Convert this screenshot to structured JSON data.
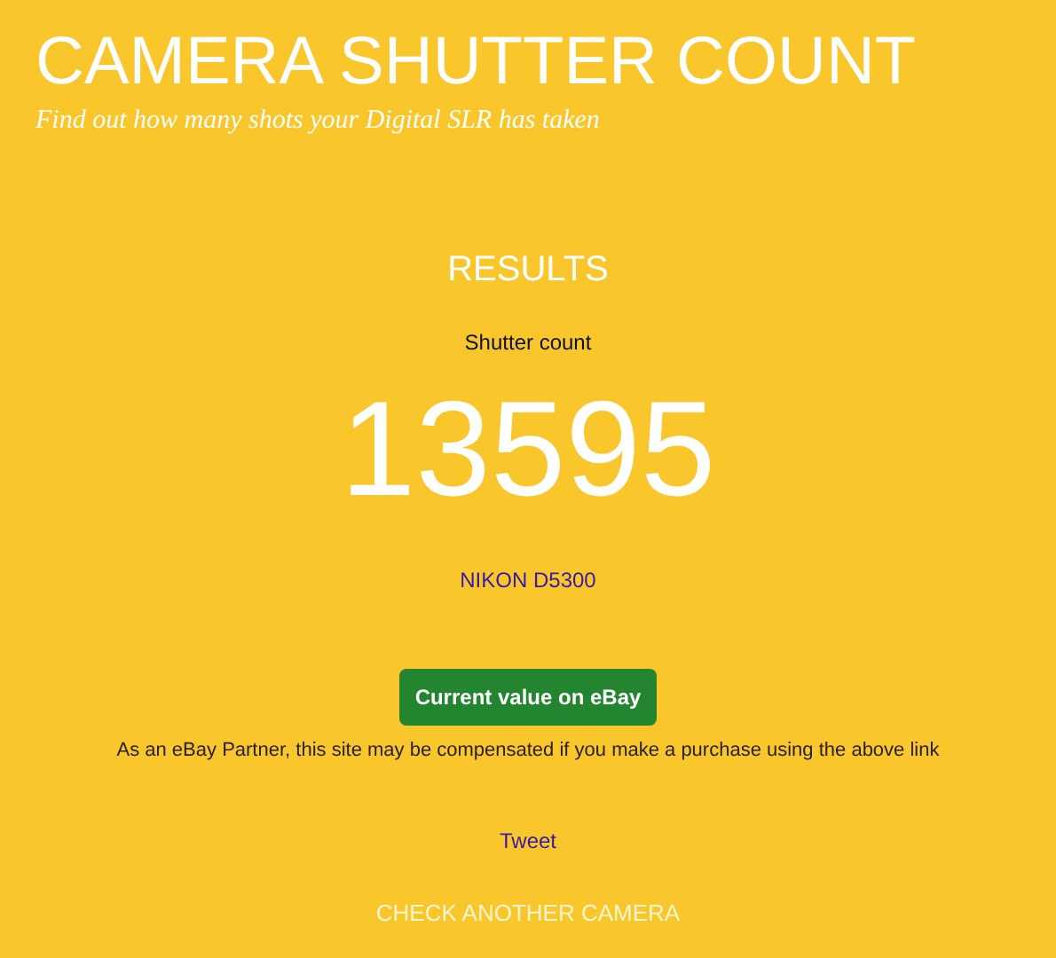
{
  "header": {
    "title": "CAMERA SHUTTER COUNT",
    "tagline": "Find out how many shots your Digital SLR has taken"
  },
  "results": {
    "heading": "RESULTS",
    "label": "Shutter count",
    "count": "13595",
    "camera_model": "NIKON D5300"
  },
  "ebay_button": "Current value on eBay",
  "disclaimer": "As an eBay Partner, this site may be compensated if you make a purchase using the above link",
  "tweet_link": "Tweet",
  "check_another_link": "CHECK ANOTHER CAMERA"
}
